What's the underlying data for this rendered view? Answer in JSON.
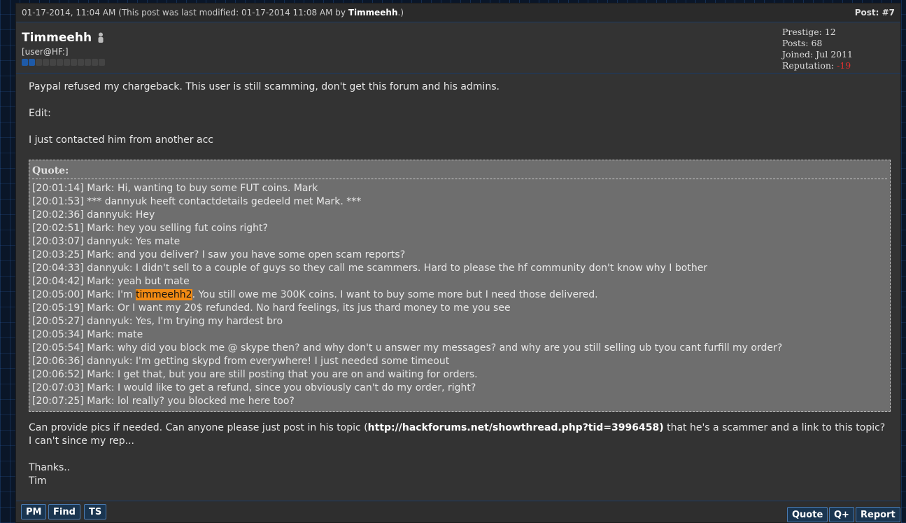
{
  "post": {
    "timestamp": "01-17-2014, 11:04 AM (This post was last modified: 01-17-2014 11:08 AM by ",
    "modified_by": "Timmeehh",
    "timestamp_end": ".)",
    "number": "Post: #7"
  },
  "author": {
    "name": "Timmeehh",
    "usertitle": "[user@HF:]",
    "status_icon": "offline-person-icon",
    "rep_level": 2,
    "rep_total": 10
  },
  "stats": {
    "prestige": "Prestige: 12",
    "posts": "Posts: 68",
    "joined": "Joined: Jul 2011",
    "reputation_label": "Reputation: ",
    "reputation_value": "-19"
  },
  "body": {
    "p1": "Paypal refused my chargeback. This user is still scamming, don't get this forum and his admins.",
    "p2": "Edit:",
    "p3": "I just contacted him from another acc",
    "quote_title": "Quote:",
    "quote_lines": [
      "[20:01:14] Mark: Hi, wanting to buy some FUT coins. Mark",
      "[20:01:53] *** dannyuk heeft contactdetails gedeeld met Mark. ***",
      "[20:02:36] dannyuk: Hey",
      "[20:02:51] Mark: hey you selling fut coins right?",
      "[20:03:07] dannyuk: Yes mate",
      "[20:03:25] Mark: and you deliver? I saw you have some open scam reports?",
      "[20:04:33] dannyuk: I didn't sell to a couple of guys so they call me scammers. Hard to please the hf community don't know why I bother",
      "[20:04:42] Mark: yeah but mate"
    ],
    "highlight_line": {
      "before": "[20:05:00] Mark: I'm ",
      "highlight": "timmeehh2",
      "after": ". You still owe me 300K coins. I want to buy some more but I need those delivered."
    },
    "quote_lines_2": [
      "[20:05:19] Mark: Or I want my 20$ refunded. No hard feelings, its jus thard money to me you see",
      "[20:05:27] dannyuk: Yes, I'm trying my hardest bro",
      "[20:05:34] Mark: mate",
      "[20:05:54] Mark: why did you block me @ skype then? and why don't u answer my messages? and why are you still selling ub tyou cant furfill my order?",
      "[20:06:36] dannyuk: I'm getting skypd from everywhere! I just needed some timeout",
      "[20:06:52] Mark: I get that, but you are still posting that you are on and waiting for orders.",
      "[20:07:03] Mark: I would like to get a refund, since you obviously can't do my order, right?",
      "[20:07:25] Mark: lol really? you blocked me here too?"
    ],
    "p4_before": "Can provide pics if needed. Can anyone please just post in his topic (",
    "p4_link": "http://hackforums.net/showthread.php?tid=3996458)",
    "p4_after": " that he's a scammer and a link to this topic? I can't since my rep...",
    "p5": "Thanks..",
    "p6": "Tim"
  },
  "buttons": {
    "pm": "PM",
    "find": "Find",
    "ts": "TS",
    "quote": "Quote",
    "qplus": "Q+",
    "report": "Report"
  }
}
